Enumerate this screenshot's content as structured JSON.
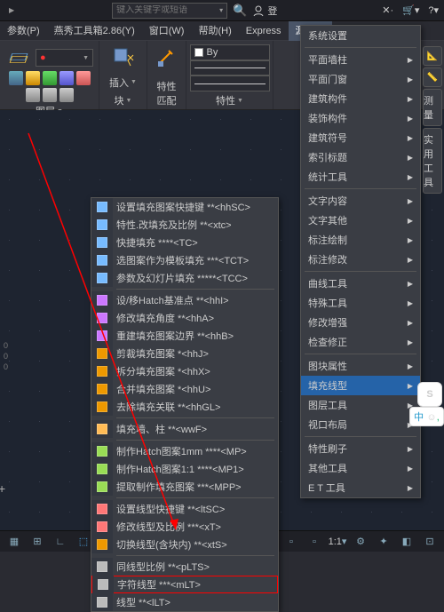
{
  "topbar": {
    "search_placeholder": "键入关键字或短语",
    "login_label": "登"
  },
  "menus": [
    "参数(P)",
    "燕秀工具箱2.86(Y)",
    "窗口(W)",
    "帮助(H)",
    "Express",
    "源泉设"
  ],
  "ribbon": {
    "layer_label": "图层",
    "insert_label": "插入",
    "match_label": "特性匹配",
    "by_label": "By",
    "props_label": "特性",
    "measure_label": "测量",
    "util_label": "实用工具",
    "block_label": "块"
  },
  "context_menu": {
    "groups": [
      [
        {
          "label": "设置填充图案快捷键 **<hhSC>"
        },
        {
          "label": "特性.改填充及比例 **<xtc>"
        },
        {
          "label": "快捷填充        ****<TC>"
        },
        {
          "label": "选图案作为模板填充 ***<TCT>"
        },
        {
          "label": "参数及幻灯片填充 *****<TCC>"
        }
      ],
      [
        {
          "label": "设/移Hatch基准点  **<hhI>"
        },
        {
          "label": "修改填充角度     **<hhA>"
        },
        {
          "label": "重建填充图案边界 **<hhB>"
        },
        {
          "label": "剪裁填充图案    *<hhJ>"
        },
        {
          "label": "拆分填充图案    *<hhX>"
        },
        {
          "label": "合并填充图案    *<hhU>"
        },
        {
          "label": "去除填充关联    **<hhGL>"
        }
      ],
      [
        {
          "label": "填充墙、柱      **<wwF>"
        }
      ],
      [
        {
          "label": "制作Hatch图案1mm ****<MP>"
        },
        {
          "label": "制作Hatch图案1:1 ****<MP1>"
        },
        {
          "label": "提取制作填充图案 ***<MPP>"
        }
      ],
      [
        {
          "label": "设置线型快捷键 **<ltSC>"
        },
        {
          "label": "修改线型及比例  ***<xT>"
        },
        {
          "label": "切换线型(含块内) **<xtS>"
        }
      ],
      [
        {
          "label": "同线型比例 **<pLTS>"
        },
        {
          "label": "字符线型   ***<mLT>",
          "highlight": true
        },
        {
          "label": "线型      **<lLT>"
        }
      ]
    ]
  },
  "float_menu": {
    "items": [
      {
        "label": "系统设置",
        "arrow": false,
        "prev_sep": false
      },
      {
        "label": "平面墙柱",
        "arrow": true,
        "prev_sep": true
      },
      {
        "label": "平面门窗",
        "arrow": true,
        "prev_sep": false
      },
      {
        "label": "建筑构件",
        "arrow": true,
        "prev_sep": false
      },
      {
        "label": "装饰构件",
        "arrow": true,
        "prev_sep": false
      },
      {
        "label": "建筑符号",
        "arrow": true,
        "prev_sep": false
      },
      {
        "label": "索引标题",
        "arrow": true,
        "prev_sep": false
      },
      {
        "label": "统计工具",
        "arrow": true,
        "prev_sep": false
      },
      {
        "label": "文字内容",
        "arrow": true,
        "prev_sep": true
      },
      {
        "label": "文字其他",
        "arrow": true,
        "prev_sep": false
      },
      {
        "label": "标注绘制",
        "arrow": true,
        "prev_sep": false
      },
      {
        "label": "标注修改",
        "arrow": true,
        "prev_sep": false
      },
      {
        "label": "曲线工具",
        "arrow": true,
        "prev_sep": true
      },
      {
        "label": "特殊工具",
        "arrow": true,
        "prev_sep": false
      },
      {
        "label": "修改增强",
        "arrow": true,
        "prev_sep": false
      },
      {
        "label": "检查修正",
        "arrow": true,
        "prev_sep": false
      },
      {
        "label": "图块属性",
        "arrow": true,
        "prev_sep": true
      },
      {
        "label": "填充线型",
        "arrow": true,
        "selected": true,
        "prev_sep": false
      },
      {
        "label": "图层工具",
        "arrow": true,
        "prev_sep": false
      },
      {
        "label": "视口布局",
        "arrow": true,
        "prev_sep": false
      },
      {
        "label": "特性刷子",
        "arrow": true,
        "prev_sep": true
      },
      {
        "label": "其他工具",
        "arrow": true,
        "prev_sep": false
      },
      {
        "label": "E T 工具",
        "arrow": true,
        "prev_sep": false
      }
    ]
  },
  "status": {
    "scale": "1:1"
  },
  "ime": {
    "s": "S",
    "zhong": "中",
    "emo": "☺"
  }
}
